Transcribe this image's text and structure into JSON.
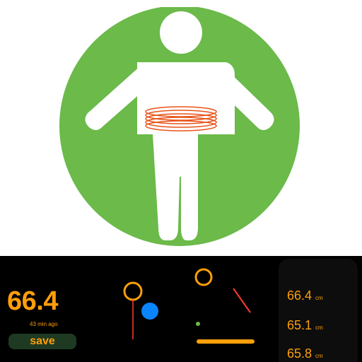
{
  "app_icon": {
    "name": "waist-measurement-icon",
    "background_color": "#6bba4a",
    "figure_color": "#ffffff",
    "tape_color": "#e8541a"
  },
  "current": {
    "value": "66.4",
    "time_ago": "43 min ago",
    "save_label": "save"
  },
  "history": [
    {
      "value": "66.4",
      "unit": "cm"
    },
    {
      "value": "65.1",
      "unit": "cm"
    },
    {
      "value": "65.8",
      "unit": "cm"
    }
  ],
  "colors": {
    "accent": "#ff9f0a",
    "blue": "#0a84ff",
    "red": "#ff3b30",
    "save_bg": "#1f3a23"
  },
  "icons": [
    "ring-icon",
    "blue-dot-icon",
    "needle-icon",
    "progress-bar-icon"
  ]
}
